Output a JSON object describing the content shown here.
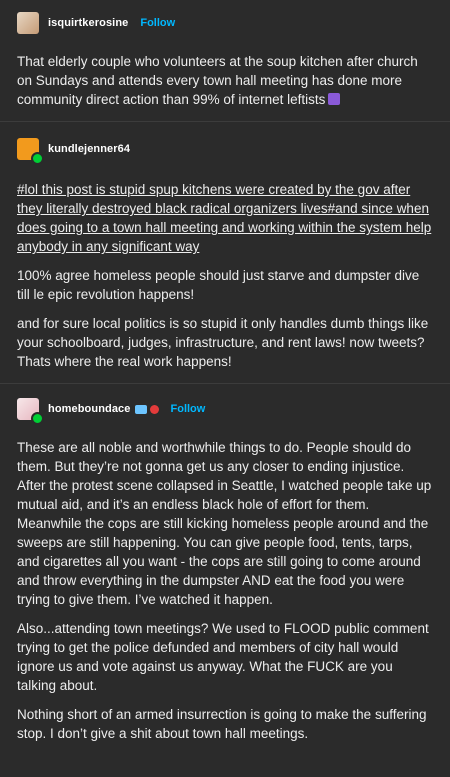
{
  "posts": [
    {
      "username": "isquirtkerosine",
      "follow_label": "Follow",
      "paragraphs": [
        "That elderly couple who volunteers at the soup kitchen after church on Sundays and attends every town hall meeting has done more community direct action than 99% of internet leftists"
      ],
      "emoji": "purple-alien-emoji"
    },
    {
      "username": "kundlejenner64",
      "paragraphs": [
        "#lol this post is stupid spup kitchens were created by the gov after they literally destroyed black radical organizers lives#and since when does going to a town hall meeting and working within the system help anybody in any significant way",
        "100% agree homeless people should just starve and dumpster dive till le epic revolution happens!",
        "and for sure local politics is so stupid it only handles dumb things like your schoolboard, judges, infrastructure, and rent laws! now tweets? Thats where the real work happens!"
      ]
    },
    {
      "username": "homeboundace",
      "follow_label": "Follow",
      "paragraphs": [
        "These are all noble and worthwhile things to do. People should do them. But they’re not gonna get us any closer to ending injustice. After the protest scene collapsed in Seattle, I watched people take up mutual aid, and it’s an endless black hole of effort for them. Meanwhile the cops are still kicking homeless people around and the sweeps are still happening. You can give people food, tents, tarps, and cigarettes all you want - the cops are still going to come around and throw everything in the dumpster AND eat the food you were trying to give them. I’ve watched it happen.",
        "Also...attending town meetings? We used to FLOOD public comment trying to get the police defunded and members of city hall would ignore us and vote against us anyway. What the FUCK are you talking about.",
        "Nothing short of an armed insurrection is going to make the suffering stop. I don’t give a shit about town hall meetings."
      ]
    }
  ]
}
